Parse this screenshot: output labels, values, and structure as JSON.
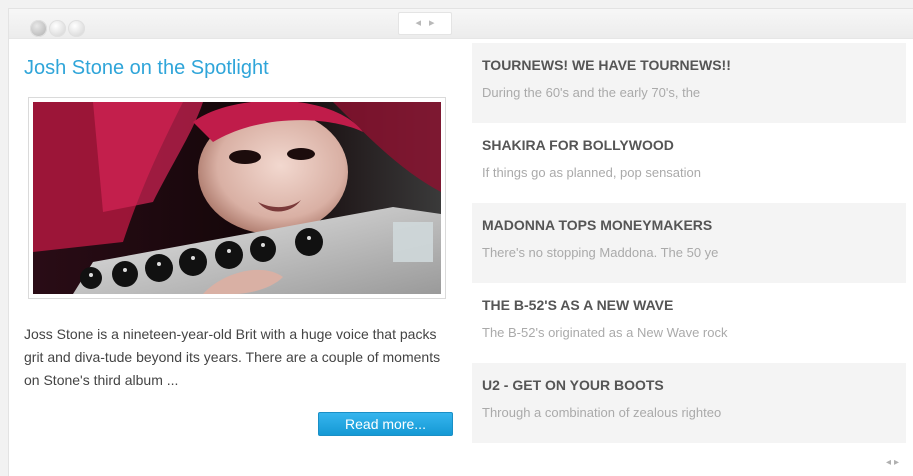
{
  "header": {
    "prev_arrow": "◂",
    "next_arrow": "▸"
  },
  "feature": {
    "title": "Josh Stone on the Spotlight",
    "text": "Joss Stone is a nineteen-year-old Brit with a huge voice that packs grit and diva-tude beyond its years. There are a couple of moments on Stone's third album ...",
    "read_more_label": "Read more..."
  },
  "news": [
    {
      "title": "TOURNEWS! WE HAVE TOURNEWS!!",
      "snippet": "During the 60's and the early 70's, the"
    },
    {
      "title": "SHAKIRA FOR BOLLYWOOD",
      "snippet": "If things go as planned, pop sensation"
    },
    {
      "title": "MADONNA TOPS MONEYMAKERS",
      "snippet": "There's no stopping Maddona. The 50 ye"
    },
    {
      "title": "THE B-52'S AS A NEW WAVE",
      "snippet": "The B-52's originated as a New Wave rock"
    },
    {
      "title": "U2 - GET ON YOUR BOOTS",
      "snippet": "Through a combination of zealous righteo"
    }
  ],
  "footer": {
    "prev_arrow": "◂",
    "next_arrow": "▸"
  },
  "colors": {
    "accent": "#2fa5d9",
    "button": "#1a9fdb",
    "shaded_row": "#f4f4f4"
  }
}
